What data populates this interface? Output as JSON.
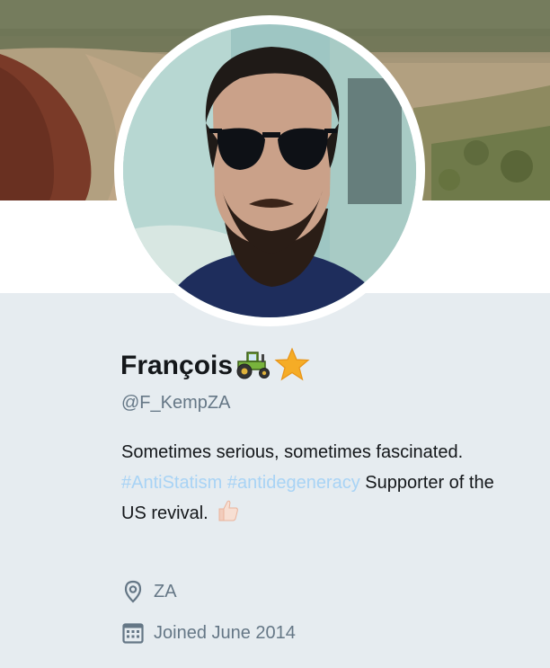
{
  "profile": {
    "name": "François",
    "handle": "@F_KempZA",
    "bio": {
      "text_1": "Sometimes serious, sometimes fascinated.",
      "hashtag_1": "#AntiStatism",
      "hashtag_2": "#antidegeneracy",
      "text_2": "Supporter of the US revival."
    },
    "location": "ZA",
    "joined": "Joined June 2014"
  },
  "icons": {
    "name_emojis": [
      "tractor-icon",
      "star-icon"
    ],
    "bio_emoji": "thumbs-up-icon",
    "location_icon": "location-pin-icon",
    "joined_icon": "calendar-icon"
  },
  "colors": {
    "background": "#e6ecf0",
    "name": "#14171a",
    "secondary_text": "#657786",
    "hashtag": "#a8d3f5"
  }
}
